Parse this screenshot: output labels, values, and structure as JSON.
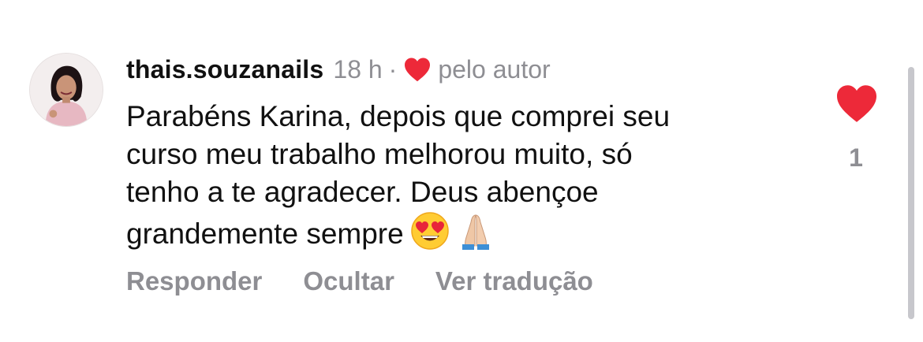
{
  "comment": {
    "username": "thais.souzanails",
    "time": "18 h",
    "separator": "·",
    "liked_by_author": "pelo autor",
    "text_lines": [
      "Parabéns Karina, depois que comprei seu",
      "curso meu trabalho melhorou muito, só",
      "tenho a te agradecer. Deus abençoe",
      "grandemente sempre"
    ],
    "emojis": [
      "heart-eyes-emoji",
      "folded-hands-emoji"
    ],
    "like_count": "1"
  },
  "actions": {
    "reply": "Responder",
    "hide": "Ocultar",
    "translate": "Ver tradução"
  },
  "colors": {
    "heart": "#ed2939",
    "secondary_text": "#8e8e93",
    "primary_text": "#111111"
  }
}
